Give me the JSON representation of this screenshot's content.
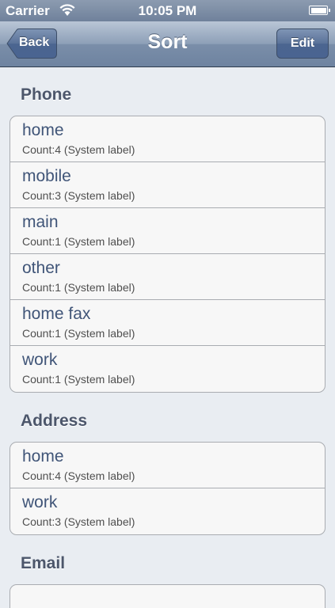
{
  "status_bar": {
    "carrier": "Carrier",
    "time": "10:05 PM"
  },
  "nav": {
    "back_label": "Back",
    "title": "Sort",
    "edit_label": "Edit"
  },
  "sections": [
    {
      "header": "Phone",
      "rows": [
        {
          "title": "home",
          "subtitle": "Count:4 (System label)"
        },
        {
          "title": "mobile",
          "subtitle": "Count:3 (System label)"
        },
        {
          "title": "main",
          "subtitle": "Count:1 (System label)"
        },
        {
          "title": "other",
          "subtitle": "Count:1 (System label)"
        },
        {
          "title": "home fax",
          "subtitle": "Count:1 (System label)"
        },
        {
          "title": "work",
          "subtitle": "Count:1 (System label)"
        }
      ]
    },
    {
      "header": "Address",
      "rows": [
        {
          "title": "home",
          "subtitle": "Count:4 (System label)"
        },
        {
          "title": "work",
          "subtitle": "Count:3 (System label)"
        }
      ]
    },
    {
      "header": "Email",
      "rows": []
    }
  ]
}
